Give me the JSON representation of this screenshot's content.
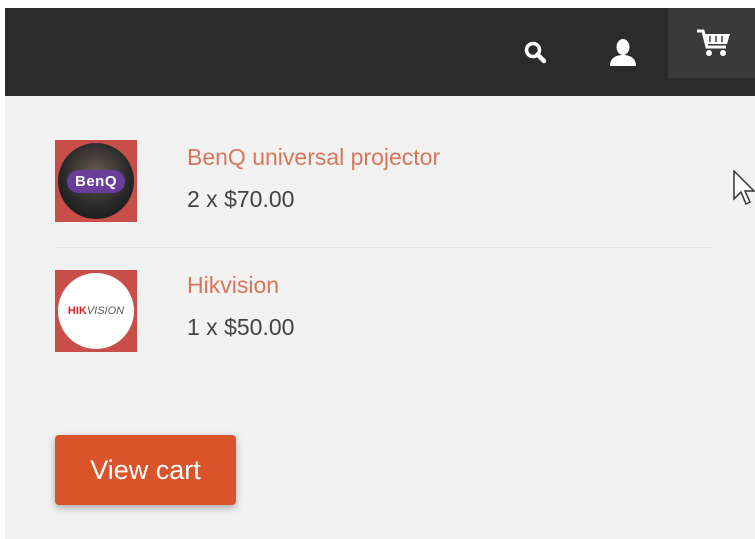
{
  "header": {
    "icons": {
      "search": "search-icon",
      "user": "user-icon",
      "cart": "cart-icon"
    }
  },
  "cart": {
    "items": [
      {
        "name": "BenQ universal projector",
        "quantity_price": "2 x $70.00",
        "thumb_icon": "benq-logo",
        "thumb_text": "BenQ"
      },
      {
        "name": "Hikvision",
        "quantity_price": "1 x $50.00",
        "thumb_icon": "hikvision-logo",
        "thumb_text_red": "HIK",
        "thumb_text_grey": "VISION"
      }
    ],
    "view_cart_label": "View cart"
  },
  "colors": {
    "header_bg": "#2b2b2b",
    "panel_bg": "#f2f2f2",
    "link": "#d9765a",
    "button": "#d9542b"
  }
}
